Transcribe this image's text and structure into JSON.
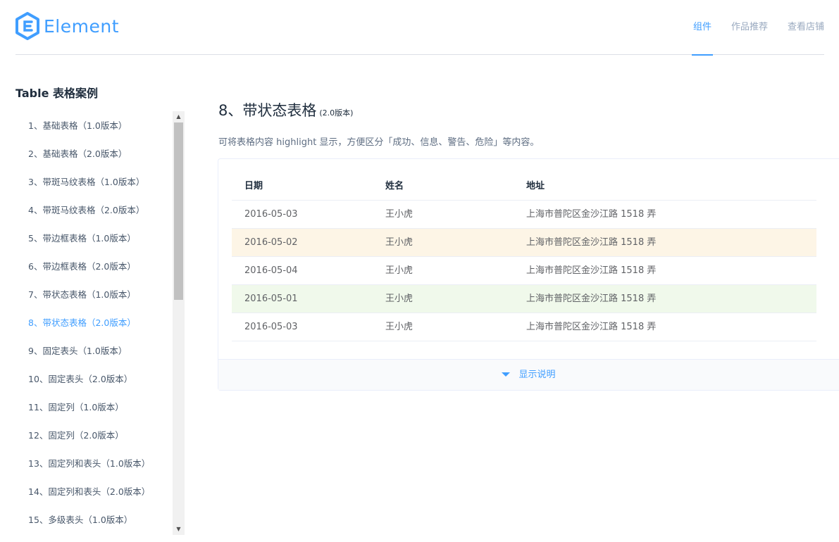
{
  "header": {
    "logo_text": "Element",
    "nav": [
      {
        "label": "组件",
        "active": true
      },
      {
        "label": "作品推荐",
        "active": false
      },
      {
        "label": "查看店铺",
        "active": false
      }
    ]
  },
  "sidebar": {
    "title": "Table 表格案例",
    "items": [
      "1、基础表格（1.0版本）",
      "2、基础表格（2.0版本）",
      "3、带斑马纹表格（1.0版本）",
      "4、带斑马纹表格（2.0版本）",
      "5、带边框表格（1.0版本）",
      "6、带边框表格（2.0版本）",
      "7、带状态表格（1.0版本）",
      "8、带状态表格（2.0版本）",
      "9、固定表头（1.0版本）",
      "10、固定表头（2.0版本）",
      "11、固定列（1.0版本）",
      "12、固定列（2.0版本）",
      "13、固定列和表头（1.0版本）",
      "14、固定列和表头（2.0版本）",
      "15、多级表头（1.0版本）"
    ],
    "active_index": 7
  },
  "main": {
    "title": "8、带状态表格",
    "title_version": "(2.0版本)",
    "description": "可将表格内容 highlight 显示，方便区分「成功、信息、警告、危险」等内容。",
    "table": {
      "headers": [
        "日期",
        "姓名",
        "地址"
      ],
      "rows": [
        {
          "date": "2016-05-03",
          "name": "王小虎",
          "address": "上海市普陀区金沙江路 1518 弄",
          "status": ""
        },
        {
          "date": "2016-05-02",
          "name": "王小虎",
          "address": "上海市普陀区金沙江路 1518 弄",
          "status": "warning"
        },
        {
          "date": "2016-05-04",
          "name": "王小虎",
          "address": "上海市普陀区金沙江路 1518 弄",
          "status": ""
        },
        {
          "date": "2016-05-01",
          "name": "王小虎",
          "address": "上海市普陀区金沙江路 1518 弄",
          "status": "success"
        },
        {
          "date": "2016-05-03",
          "name": "王小虎",
          "address": "上海市普陀区金沙江路 1518 弄",
          "status": ""
        }
      ]
    },
    "toggle_label": "显示说明"
  },
  "colors": {
    "accent": "#409eff",
    "warning_row": "#fdf5e6",
    "success_row": "#f0f9eb"
  },
  "icons": {
    "logo": "element-logo-icon",
    "toggle": "caret-down-icon",
    "scroll_up": "scroll-up-arrow-icon",
    "scroll_down": "scroll-down-arrow-icon"
  }
}
